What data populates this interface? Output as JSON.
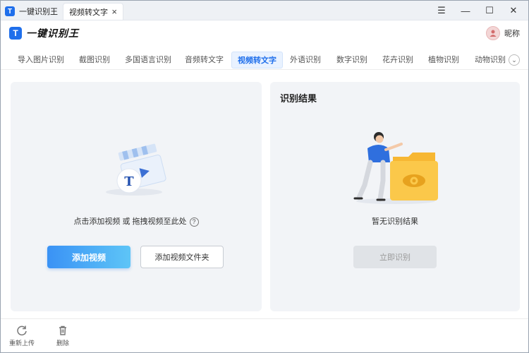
{
  "titlebar": {
    "app_title": "一键识别王",
    "active_tab": "视频转文字",
    "close_tab_glyph": "×",
    "controls": {
      "menu_glyph": "☰",
      "minimize_glyph": "—",
      "maximize_glyph": "☐",
      "close_glyph": "✕"
    }
  },
  "header": {
    "logo_letter": "T",
    "brand": "一键识别王",
    "user_name": "昵称"
  },
  "nav": {
    "items": [
      {
        "label": "导入图片识别"
      },
      {
        "label": "截图识别"
      },
      {
        "label": "多国语言识别"
      },
      {
        "label": "音频转文字"
      },
      {
        "label": "视频转文字"
      },
      {
        "label": "外语识别"
      },
      {
        "label": "数字识别"
      },
      {
        "label": "花卉识别"
      },
      {
        "label": "植物识别"
      },
      {
        "label": "动物识别"
      }
    ],
    "active_index": 4,
    "more_glyph": "⌄"
  },
  "upload_panel": {
    "hint": "点击添加视频 或 拖拽视频至此处",
    "help_glyph": "?",
    "add_video": "添加视频",
    "add_folder": "添加视频文件夹",
    "illustration_letter": "T"
  },
  "result_panel": {
    "title": "识别结果",
    "empty": "暂无识别结果",
    "recognize": "立即识别"
  },
  "footer": {
    "reupload": "重新上传",
    "delete": "删除"
  },
  "colors": {
    "accent": "#1f6feb",
    "primary_gradient_start": "#3a92f5",
    "primary_gradient_end": "#5ec5f7",
    "panel_bg": "#f2f4f7",
    "folder": "#f7b733"
  },
  "icons": [
    "app-logo-icon",
    "close-icon",
    "menu-icon",
    "minimize-icon",
    "maximize-icon",
    "avatar-icon",
    "chevron-down-icon",
    "help-icon",
    "video-clapper-illustration",
    "folder-eye-illustration",
    "refresh-icon",
    "trash-icon"
  ]
}
